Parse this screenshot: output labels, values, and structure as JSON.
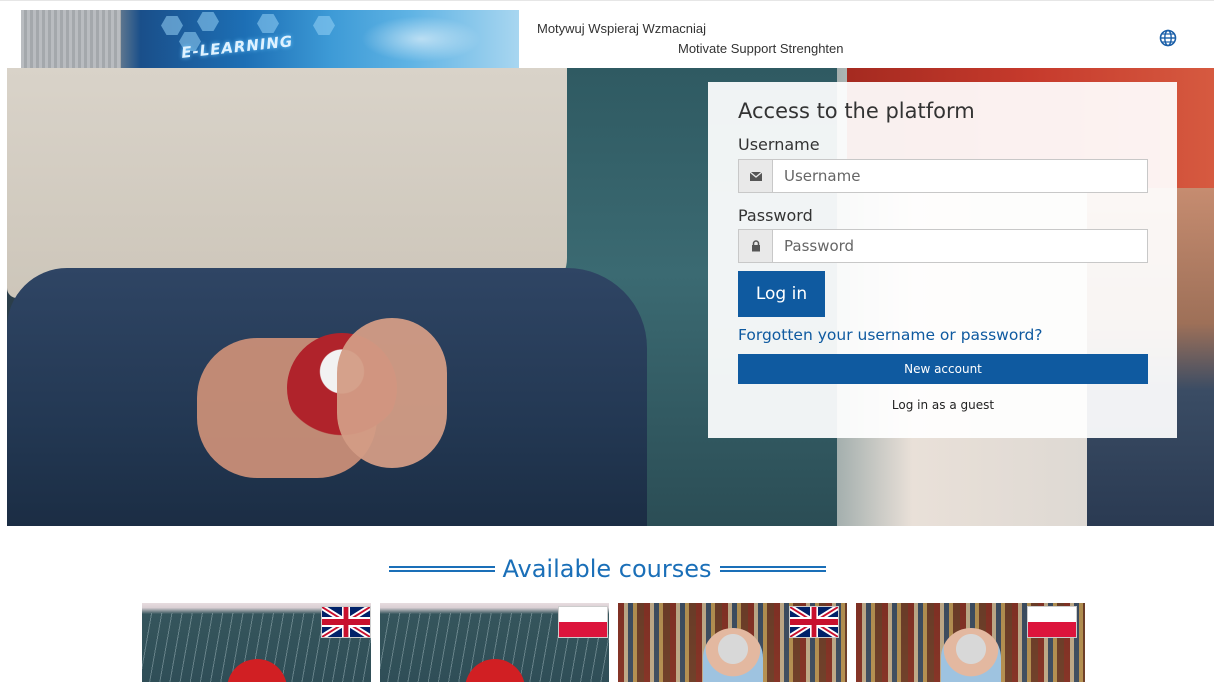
{
  "header": {
    "tagline_pl": "Motywuj Wspieraj Wzmacniaj",
    "tagline_en": "Motivate Support Strenghten",
    "banner_text": "E-LEARNING",
    "language_icon": "globe-icon"
  },
  "login": {
    "title": "Access to the platform",
    "username_label": "Username",
    "username_placeholder": "Username",
    "username_icon": "envelope-icon",
    "password_label": "Password",
    "password_placeholder": "Password",
    "password_icon": "lock-icon",
    "login_button": "Log in",
    "forgot_link": "Forgotten your username or password?",
    "new_account_button": "New account",
    "guest_link": "Log in as a guest"
  },
  "courses": {
    "title": "Available courses",
    "items": [
      {
        "image": "rain-umbrella",
        "flag": "uk"
      },
      {
        "image": "rain-umbrella",
        "flag": "pl"
      },
      {
        "image": "man-bookshelf",
        "flag": "uk"
      },
      {
        "image": "man-bookshelf",
        "flag": "pl"
      }
    ]
  },
  "colors": {
    "primary": "#0f5aa0",
    "accent_title": "#1a6fb8"
  }
}
